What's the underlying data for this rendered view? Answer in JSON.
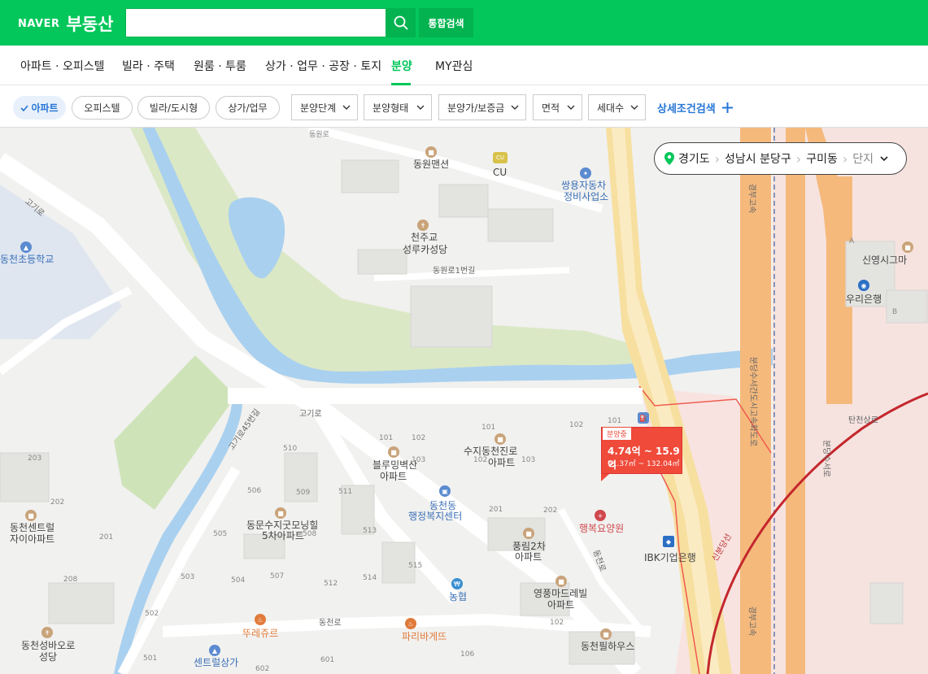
{
  "header": {
    "logo_naver": "NAVER",
    "logo_title": "부동산",
    "search_placeholder": "",
    "combined_search": "통합검색"
  },
  "nav": {
    "items": [
      "아파트 · 오피스텔",
      "빌라 · 주택",
      "원룸 · 투룸",
      "상가 · 업무 · 공장 · 토지",
      "분양",
      "MY관심"
    ],
    "active": "분양"
  },
  "filters": {
    "chips": [
      "아파트",
      "오피스텔",
      "빌라/도시형",
      "상가/업무"
    ],
    "active_chip": "아파트",
    "dropdowns": [
      "분양단계",
      "분양형태",
      "분양가/보증금",
      "면적",
      "세대수"
    ],
    "advanced": "상세조건검색"
  },
  "breadcrumb": {
    "province": "경기도",
    "city": "성남시 분당구",
    "dong": "구미동",
    "complex": "단지"
  },
  "marker": {
    "tag": "분양중",
    "price": "4.74억 ~ 15.9억",
    "area": "51.37㎡ ~ 132.04㎡"
  },
  "map_labels": {
    "dongwon_mansion": "동원맨션",
    "cu": "CU",
    "ssangyong": "쌍용자동차",
    "ssangyong2": "정비사업소",
    "catholic": "천주교",
    "catholic2": "성루카성당",
    "dongwon_ro": "동원로1번길",
    "dongwon_ro_top": "동원로",
    "dongcheon_school": "동천초등학교",
    "gogi_ro_1": "고기로",
    "gogi_ro_2": "고기로",
    "gogi_ro_45": "고기로45번길",
    "bluming": "블루밍벽산",
    "bluming2": "아파트",
    "suji": "수지동천진로",
    "suji2": "아파트",
    "welfare": "동천동",
    "welfare2": "행정복지센터",
    "happy": "행복요양원",
    "ibk": "IBK기업은행",
    "pungrim": "풍림2차",
    "pungrim2": "아파트",
    "dongmun": "동문수지굿모닝힐",
    "dongmun2": "5차아파트",
    "central": "동천센트럴",
    "central2": "자이아파트",
    "youngpung": "영풍마드레빌",
    "youngpung2": "아파트",
    "nonghyup": "농협",
    "tous": "뚜레쥬르",
    "paris": "파리바게뜨",
    "dongcheon_ro": "동천로",
    "dongcheon_ro2": "동천로",
    "villa_house": "동천필하우스",
    "seongba": "동천성바오로",
    "seongba2": "성당",
    "central_mall": "센트럴상가",
    "woori": "우리은행",
    "sinyoung": "신영시그마",
    "gyeongbu_1": "경부고속",
    "gyeongbu_2": "경부고속",
    "bundang_suwon": "분당수서간도시고속화도로",
    "bundang_suseo": "분당수서로",
    "sinbundang": "신분당선",
    "tancheon": "탄천상로",
    "b_101": "101",
    "b_102": "102",
    "b_103": "103",
    "b_101b": "101",
    "b_102b": "102",
    "b_103b": "103",
    "b_101c": "101",
    "b_102c": "102",
    "b_201": "201",
    "b_202": "202",
    "b_203": "203",
    "b_208": "208",
    "b_201b": "201",
    "b_202b": "202",
    "b_502": "502",
    "b_501": "501",
    "b_503": "503",
    "b_504": "504",
    "b_505": "505",
    "b_506": "506",
    "b_507": "507",
    "b_508": "508",
    "b_509": "509",
    "b_510": "510",
    "b_511": "511",
    "b_512": "512",
    "b_513": "513",
    "b_514": "514",
    "b_515": "515",
    "b_601": "601",
    "b_602": "602",
    "b_106": "106",
    "b_102d": "102",
    "b_a": "A",
    "b_b": "B"
  },
  "colors": {
    "brand": "#03c75a",
    "accent_blue": "#2575d6",
    "marker_red": "#ef4a3a"
  }
}
